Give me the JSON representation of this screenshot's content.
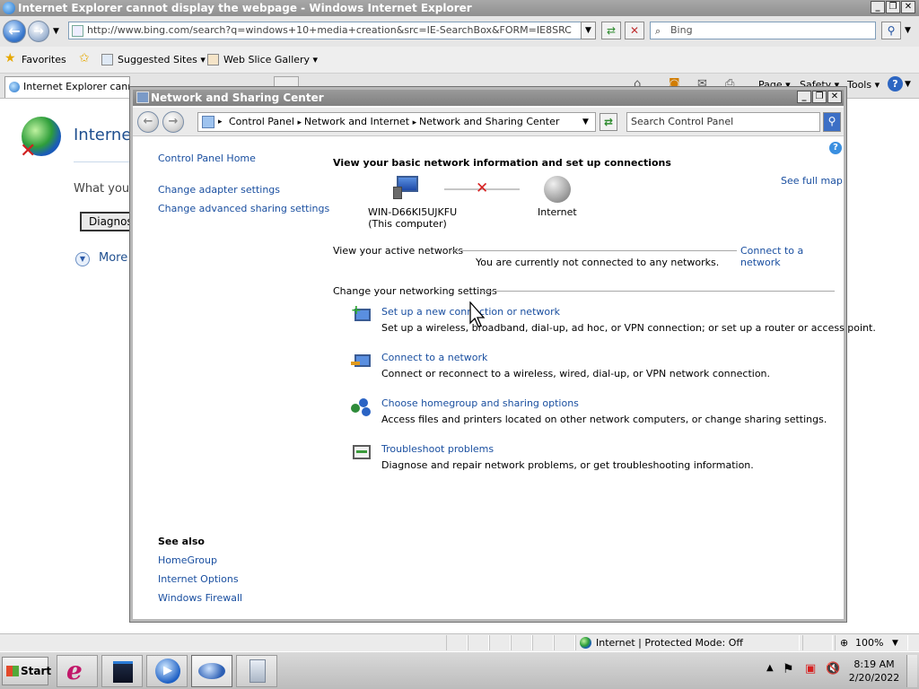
{
  "ie": {
    "window_title": "Internet Explorer cannot display the webpage - Windows Internet Explorer",
    "address": "http://www.bing.com/search?q=windows+10+media+creation&src=IE-SearchBox&FORM=IE8SRC",
    "search_placeholder": "Bing",
    "favorites_label": "Favorites",
    "suggested_sites": "Suggested Sites",
    "web_slice_gallery": "Web Slice Gallery",
    "tab_title": "Internet Explorer cannot display the webpage",
    "toolbar_page": "Page",
    "toolbar_safety": "Safety",
    "toolbar_tools": "Tools",
    "content_heading_partial": "Internet",
    "content_whatyou": "What you",
    "diagnose_button": "Diagnos",
    "more_label": "More",
    "status_zone": "Internet | Protected Mode: Off",
    "zoom": "100%"
  },
  "nsc": {
    "title": "Network and Sharing Center",
    "breadcrumb": [
      "Control Panel",
      "Network and Internet",
      "Network and Sharing Center"
    ],
    "search_placeholder": "Search Control Panel",
    "sidebar": {
      "home": "Control Panel Home",
      "links": [
        "Change adapter settings",
        "Change advanced sharing settings"
      ],
      "see_also_title": "See also",
      "see_also": [
        "HomeGroup",
        "Internet Options",
        "Windows Firewall"
      ]
    },
    "heading": "View your basic network information and set up connections",
    "see_full_map": "See full map",
    "computer_name": "WIN-D66KI5UJKFU",
    "computer_sub": "(This computer)",
    "internet_label": "Internet",
    "active_networks_label": "View your active networks",
    "connect_link": "Connect to a network",
    "not_connected": "You are currently not connected to any networks.",
    "change_settings_label": "Change your networking settings",
    "tasks": [
      {
        "title": "Set up a new connection or network",
        "desc": "Set up a wireless, broadband, dial-up, ad hoc, or VPN connection; or set up a router or access point."
      },
      {
        "title": "Connect to a network",
        "desc": "Connect or reconnect to a wireless, wired, dial-up, or VPN network connection."
      },
      {
        "title": "Choose homegroup and sharing options",
        "desc": "Access files and printers located on other network computers, or change sharing settings."
      },
      {
        "title": "Troubleshoot problems",
        "desc": "Diagnose and repair network problems, or get troubleshooting information."
      }
    ]
  },
  "taskbar": {
    "start": "Start",
    "time": "8:19 AM",
    "date": "2/20/2022"
  },
  "colors": {
    "link": "#1a4fa0",
    "disconnect_x": "#d62020"
  }
}
